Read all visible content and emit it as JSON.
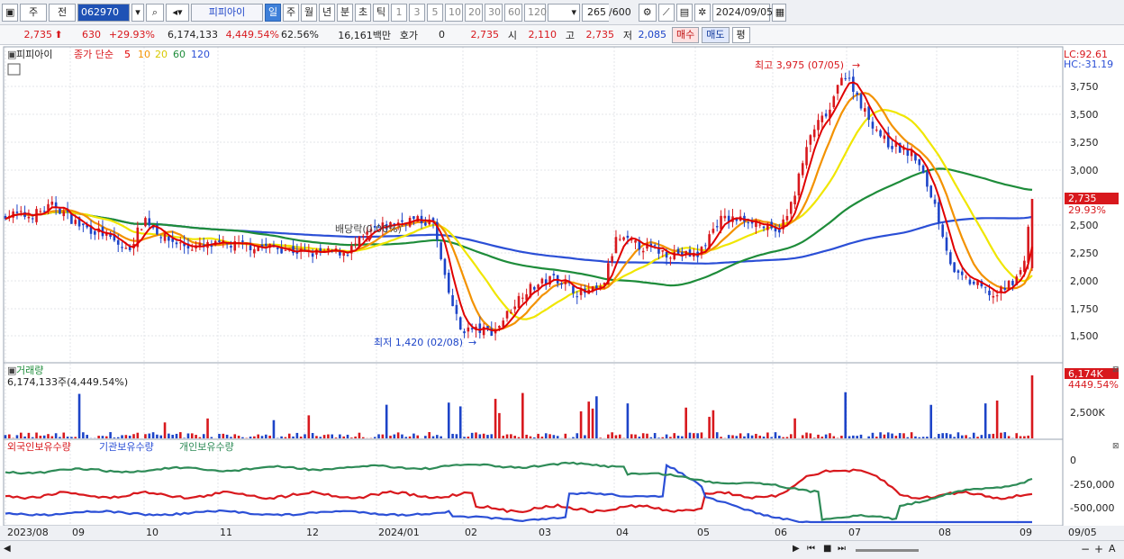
{
  "toolbar": {
    "item_type": "주",
    "item_prev": "전",
    "code": "062970",
    "name": "피피아이",
    "periods": [
      "일",
      "주",
      "월",
      "년",
      "분",
      "초",
      "틱"
    ],
    "nums": [
      "1",
      "3",
      "5",
      "10",
      "20",
      "30",
      "60",
      "120"
    ],
    "count": "265",
    "count_total": "/600",
    "date": "2024/09/05"
  },
  "quote": {
    "price": "2,735",
    "change": "630",
    "rate": "+29.93%",
    "volume": "6,174,133",
    "vol_rate": "4,449.54%",
    "turnover": "62.56%",
    "amount": "16,161백만",
    "hoga_label": "호가",
    "hoga_val": "0",
    "hoga_price": "2,735",
    "open_label": "시",
    "open": "2,110",
    "high_label": "고",
    "high": "2,735",
    "low_label": "저",
    "low": "2,085",
    "buy": "매수",
    "sell": "매도",
    "eval": "평"
  },
  "price_panel": {
    "name": "피피아이",
    "ma_title": "종가 단순",
    "ma_periods": [
      "5",
      "10",
      "20",
      "60",
      "120"
    ],
    "ma_colors": [
      "#e00000",
      "#f39200",
      "#f0e600",
      "#1e8c3a",
      "#2b4fd6"
    ],
    "lc": "LC:92.61",
    "hc": "HC:-31.19",
    "y_ticks": [
      "3,750",
      "3,500",
      "3,250",
      "3,000",
      "2,750",
      "2,500",
      "2,250",
      "2,000",
      "1,750",
      "1,500"
    ],
    "high_note": "최고 3,975 (07/05)",
    "low_note": "최저 1,420 (02/08)",
    "div_note": "배당락(0.00%)",
    "last_price": "2,735",
    "last_rate": "29.93%"
  },
  "volume_panel": {
    "title": "거래량",
    "value": "6,174,133주(4,449.54%)",
    "tick": "2,500K",
    "last": "6,174K",
    "last_rate": "4449.54%"
  },
  "holding_panel": {
    "series": [
      "외국인보유수량",
      "기관보유수량",
      "개인보유수량"
    ],
    "series_colors": [
      "#d8181d",
      "#2b4fd6",
      "#2e8b57"
    ],
    "ticks": [
      "0",
      "-250,000",
      "-500,000"
    ]
  },
  "x_axis": [
    "2023/08",
    "09",
    "10",
    "11",
    "12",
    "2024/01",
    "02",
    "03",
    "04",
    "05",
    "06",
    "07",
    "08",
    "09",
    "09/05"
  ]
}
